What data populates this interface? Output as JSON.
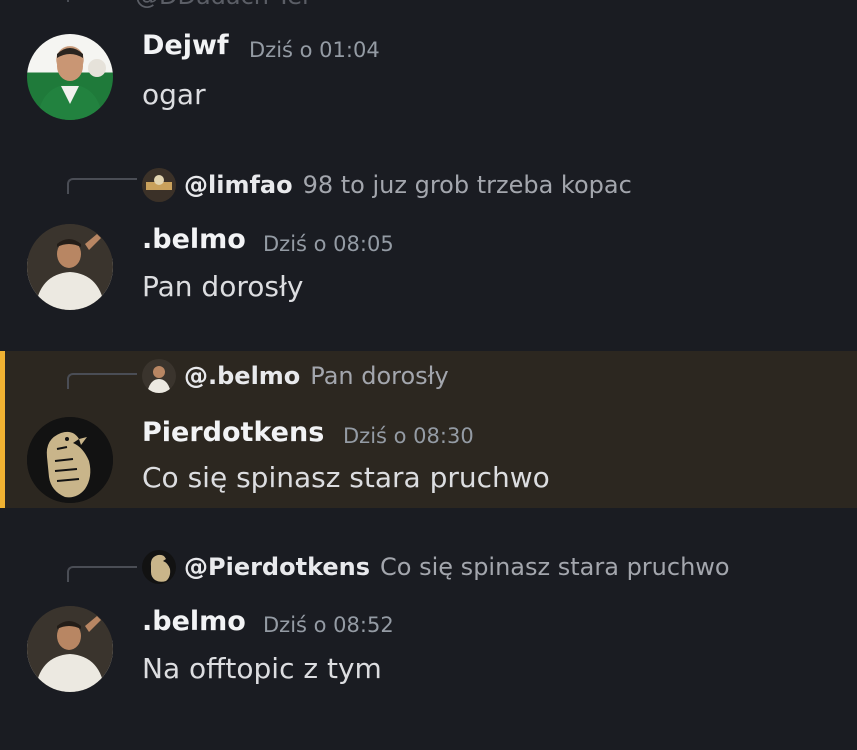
{
  "top_fragment": "@DDadach Tel",
  "messages": [
    {
      "username": "Dejwf",
      "timestamp": "Dziś o 01:04",
      "text": "ogar"
    },
    {
      "reply_to": {
        "name": "@limfao",
        "text": "98 to juz grob trzeba kopac"
      },
      "username": ".belmo",
      "timestamp": "Dziś o 08:05",
      "text": "Pan dorosły"
    },
    {
      "reply_to": {
        "name": "@.belmo",
        "text": "Pan dorosły"
      },
      "username": "Pierdotkens",
      "timestamp": "Dziś o 08:30",
      "text": "Co się spinasz stara pruchwo",
      "highlighted": true
    },
    {
      "reply_to": {
        "name": "@Pierdotkens",
        "text": "Co się spinasz stara pruchwo"
      },
      "username": ".belmo",
      "timestamp": "Dziś o 08:52",
      "text": "Na offtopic z tym"
    }
  ],
  "colors": {
    "background": "#1a1c22",
    "highlight_bg": "#2c2720",
    "highlight_bar": "#f0b232"
  }
}
